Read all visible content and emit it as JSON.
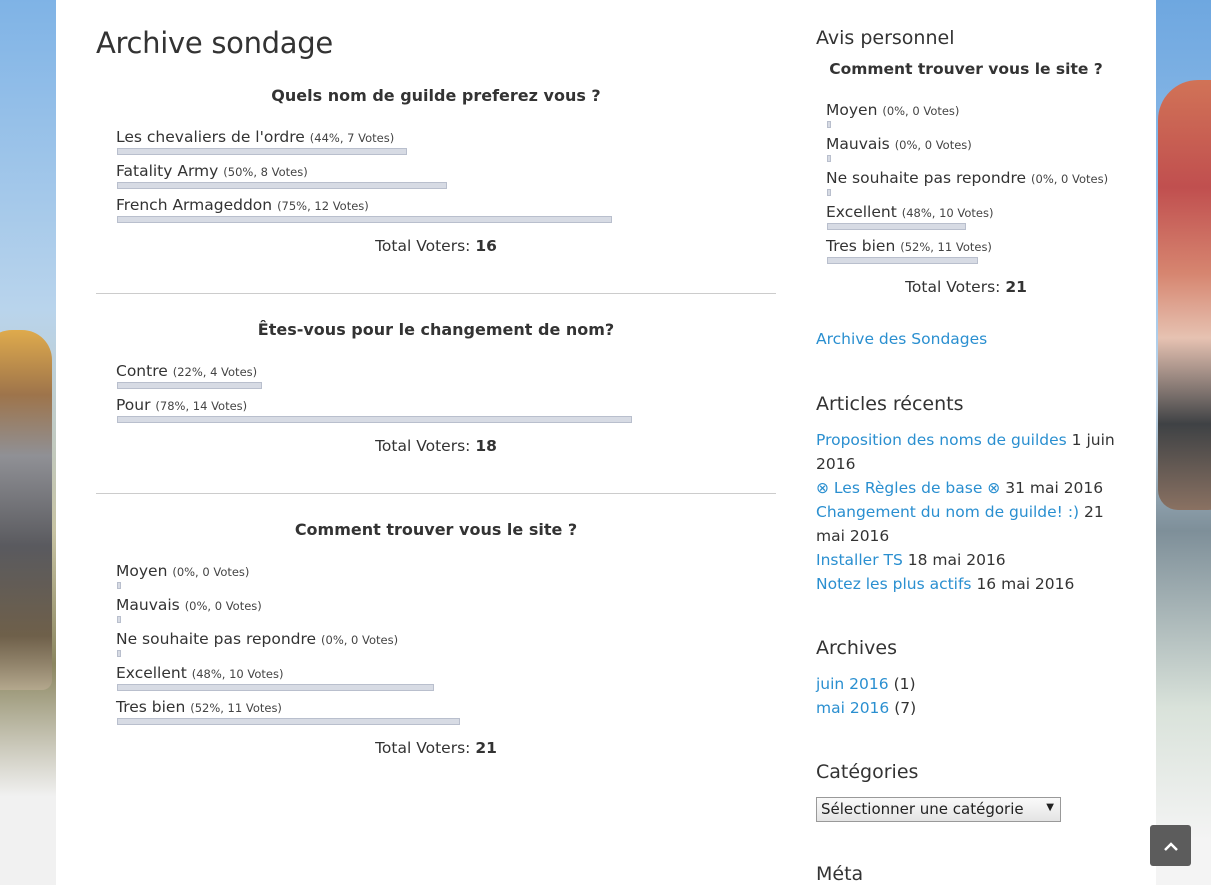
{
  "page_title": "Archive sondage",
  "polls": [
    {
      "question": "Quels nom de guilde preferez vous ?",
      "answers": [
        {
          "label": "Les chevaliers de l'ordre",
          "stat": "(44%, 7 Votes)",
          "pct": 44
        },
        {
          "label": "Fatality Army",
          "stat": "(50%, 8 Votes)",
          "pct": 50
        },
        {
          "label": "French Armageddon",
          "stat": "(75%, 12 Votes)",
          "pct": 75
        }
      ],
      "total_label": "Total Voters: ",
      "total": "16"
    },
    {
      "question": "Êtes-vous pour le changement de nom?",
      "answers": [
        {
          "label": "Contre",
          "stat": "(22%, 4 Votes)",
          "pct": 22
        },
        {
          "label": "Pour",
          "stat": "(78%, 14 Votes)",
          "pct": 78
        }
      ],
      "total_label": "Total Voters: ",
      "total": "18"
    },
    {
      "question": "Comment trouver vous le site ?",
      "answers": [
        {
          "label": "Moyen",
          "stat": "(0%, 0 Votes)",
          "pct": 0
        },
        {
          "label": "Mauvais",
          "stat": "(0%, 0 Votes)",
          "pct": 0
        },
        {
          "label": "Ne souhaite pas repondre",
          "stat": "(0%, 0 Votes)",
          "pct": 0
        },
        {
          "label": "Excellent",
          "stat": "(48%, 10 Votes)",
          "pct": 48
        },
        {
          "label": "Tres bien",
          "stat": "(52%, 11 Votes)",
          "pct": 52
        }
      ],
      "total_label": "Total Voters: ",
      "total": "21"
    }
  ],
  "sidebar": {
    "avis_title": "Avis personnel",
    "poll": {
      "question": "Comment trouver vous le site ?",
      "answers": [
        {
          "label": "Moyen",
          "stat": "(0%, 0 Votes)",
          "pct": 0
        },
        {
          "label": "Mauvais",
          "stat": "(0%, 0 Votes)",
          "pct": 0
        },
        {
          "label": "Ne souhaite pas repondre",
          "stat": "(0%, 0 Votes)",
          "pct": 0
        },
        {
          "label": "Excellent",
          "stat": "(48%, 10 Votes)",
          "pct": 48
        },
        {
          "label": "Tres bien",
          "stat": "(52%, 11 Votes)",
          "pct": 52
        }
      ],
      "total_label": "Total Voters: ",
      "total": "21"
    },
    "archive_link": "Archive des Sondages",
    "recent_title": "Articles récents",
    "recent": [
      {
        "title": "Proposition des noms de guildes",
        "date": " 1 juin 2016"
      },
      {
        "title": "⊗ Les Règles de base ⊗",
        "date": " 31 mai 2016"
      },
      {
        "title": "Changement du nom de guilde! :)",
        "date": " 21 mai 2016"
      },
      {
        "title": "Installer TS",
        "date": " 18 mai 2016"
      },
      {
        "title": "Notez les plus actifs",
        "date": " 16 mai 2016"
      }
    ],
    "archives_title": "Archives",
    "archives": [
      {
        "month": "juin 2016",
        "count": " (1)"
      },
      {
        "month": "mai 2016",
        "count": " (7)"
      }
    ],
    "categories_title": "Catégories",
    "categories_select": "Sélectionner une catégorie",
    "meta_title": "Méta"
  },
  "icons": {
    "scroll_top": "chevron-up-icon",
    "select_arrow": "triangle-down-icon"
  },
  "colors": {
    "link": "#2a8fd0",
    "bar_fill": "#d7dbe4",
    "bar_border": "#b9bfcd"
  }
}
